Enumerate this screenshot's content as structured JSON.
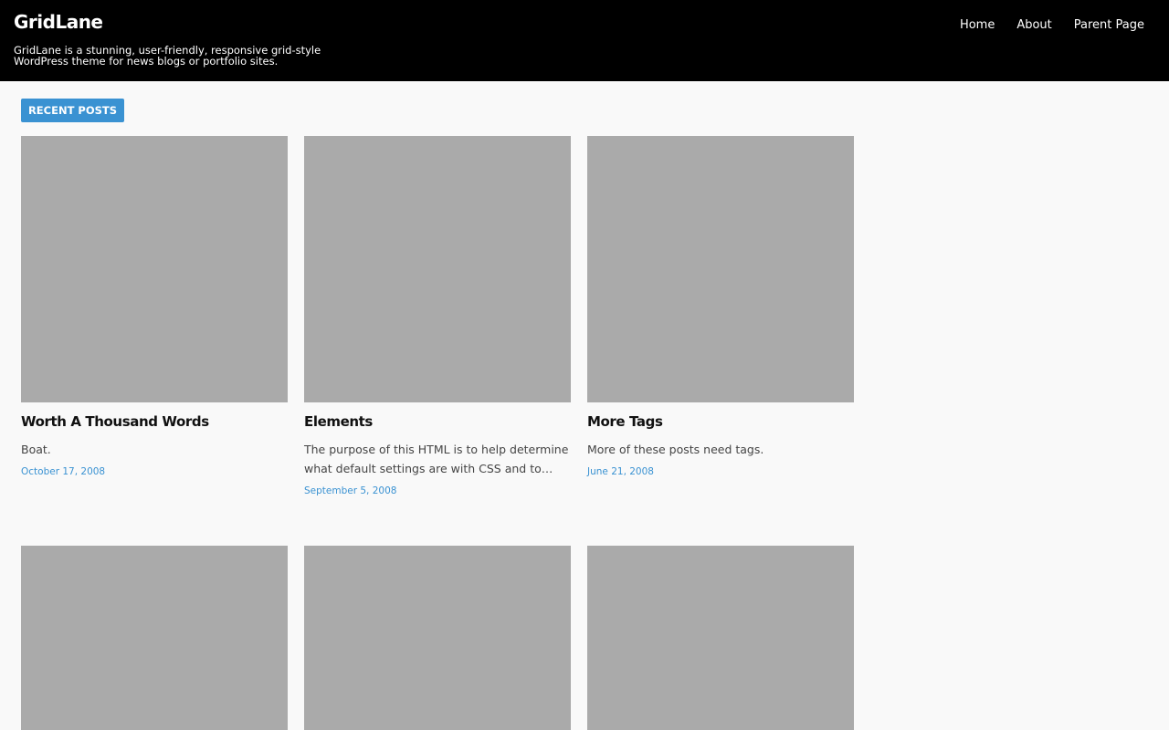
{
  "header": {
    "site_title": "GridLane",
    "site_description": "GridLane is a stunning, user-friendly, responsive grid-style WordPress theme for news blogs or portfolio sites.",
    "nav": [
      {
        "label": "Home"
      },
      {
        "label": "About"
      },
      {
        "label": "Parent Page"
      }
    ]
  },
  "section": {
    "label": "RECENT POSTS"
  },
  "posts": [
    {
      "title": "Worth A Thousand Words",
      "excerpt": "Boat.",
      "date": "October 17, 2008"
    },
    {
      "title": "Elements",
      "excerpt": "The purpose of this HTML is to help determine what default settings are with CSS and to…",
      "date": "September 5, 2008"
    },
    {
      "title": "More Tags",
      "excerpt": "More of these posts need tags.",
      "date": "June 21, 2008"
    }
  ],
  "colors": {
    "header_bg": "#000000",
    "accent": "#3a92d2",
    "thumbnail_placeholder": "#aaaaaa",
    "page_bg": "#f9f9f9"
  }
}
